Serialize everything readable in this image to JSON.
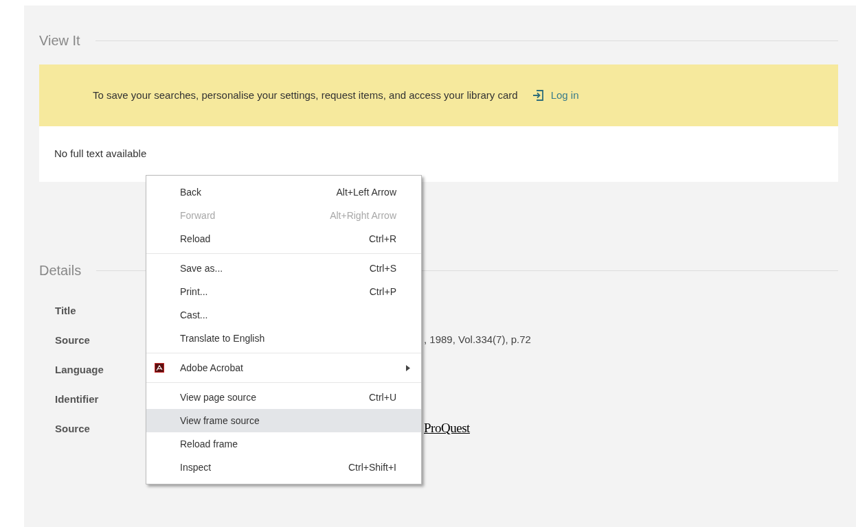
{
  "view_it": {
    "heading": "View It",
    "banner": {
      "message": "To save your searches, personalise your settings, request items, and access your library card",
      "login": "Log in"
    },
    "availability": "No full text available"
  },
  "details": {
    "heading": "Details",
    "rows": [
      {
        "label": "Title"
      },
      {
        "label": "Source",
        "value": ", 1989, Vol.334(7), p.72"
      },
      {
        "label": "Language"
      },
      {
        "label": "Identifier"
      },
      {
        "label": "Source",
        "logo": "ProQuest"
      }
    ]
  },
  "context_menu": {
    "groups": [
      [
        {
          "label": "Back",
          "shortcut": "Alt+Left Arrow",
          "disabled": false,
          "selected": false
        },
        {
          "label": "Forward",
          "shortcut": "Alt+Right Arrow",
          "disabled": true,
          "selected": false
        },
        {
          "label": "Reload",
          "shortcut": "Ctrl+R",
          "disabled": false,
          "selected": false
        }
      ],
      [
        {
          "label": "Save as...",
          "shortcut": "Ctrl+S",
          "disabled": false,
          "selected": false
        },
        {
          "label": "Print...",
          "shortcut": "Ctrl+P",
          "disabled": false,
          "selected": false
        },
        {
          "label": "Cast...",
          "disabled": false,
          "selected": false
        },
        {
          "label": "Translate to English",
          "disabled": false,
          "selected": false
        }
      ],
      [
        {
          "label": "Adobe Acrobat",
          "disabled": false,
          "selected": false,
          "kind": "submenu"
        }
      ],
      [
        {
          "label": "View page source",
          "shortcut": "Ctrl+U",
          "disabled": false,
          "selected": false
        },
        {
          "label": "View frame source",
          "disabled": false,
          "selected": true
        },
        {
          "label": "Reload frame",
          "disabled": false,
          "selected": false
        },
        {
          "label": "Inspect",
          "shortcut": "Ctrl+Shift+I",
          "disabled": false,
          "selected": false
        }
      ]
    ]
  }
}
